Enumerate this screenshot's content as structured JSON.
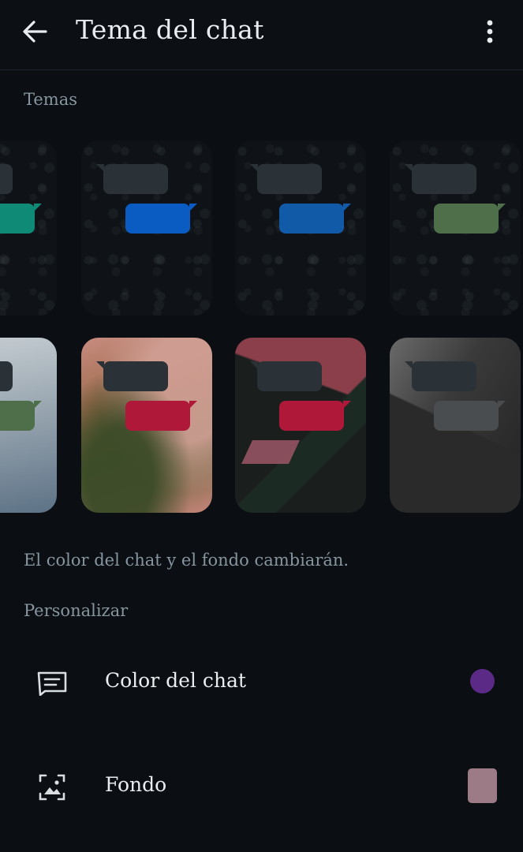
{
  "header": {
    "title": "Tema del chat",
    "back_icon": "arrow-left-icon",
    "menu_icon": "more-vertical-icon"
  },
  "themes": {
    "section_label": "Temas",
    "row1_bubble_colors": [
      "#0f8a77",
      "#0a5cc2",
      "#115aa8",
      "#4f6f4a"
    ],
    "row2_bubble_colors": [
      "#4f6f4a",
      "#b0183a",
      "#b0183a",
      "#4a4d50"
    ],
    "hint": "El color del chat y el fondo cambiarán."
  },
  "customize": {
    "section_label": "Personalizar",
    "items": [
      {
        "label": "Color del chat",
        "icon": "chat-color-icon",
        "swatch": "#5b2a86"
      },
      {
        "label": "Fondo",
        "icon": "wallpaper-icon",
        "swatch": "#9c7a86"
      }
    ]
  },
  "colors": {
    "background": "#0b0e12",
    "text_primary": "#e9edef",
    "text_secondary": "#8696a0"
  }
}
